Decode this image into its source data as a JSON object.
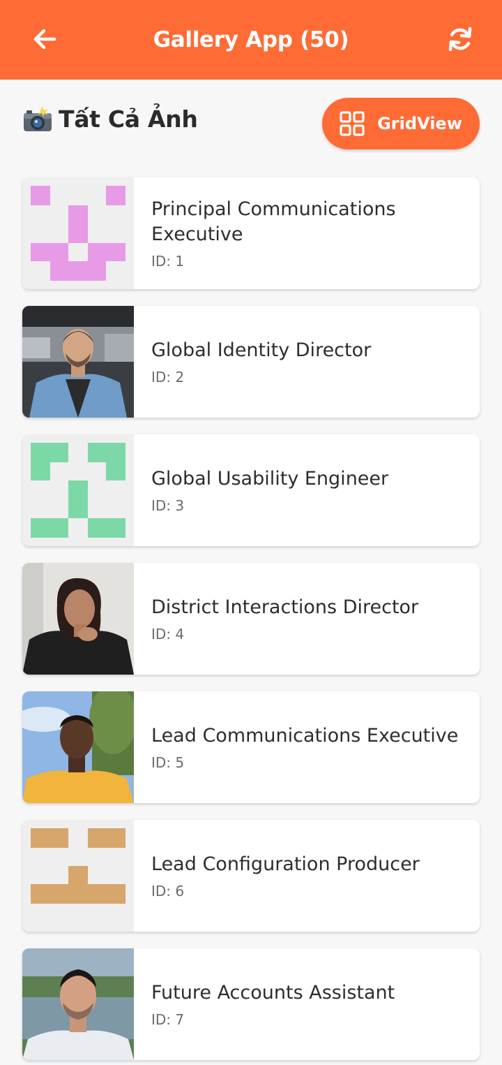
{
  "header": {
    "title": "Gallery App (50)",
    "back_icon": "arrow-left-icon",
    "refresh_icon": "refresh-icon",
    "bg_color": "#ff6b35"
  },
  "section": {
    "title": "Tất Cả Ảnh",
    "icon": "camera-flash-icon"
  },
  "view_toggle": {
    "label": "GridView",
    "icon": "grid-icon"
  },
  "items": [
    {
      "name": "Principal Communications Executive",
      "id_text": "ID: 1",
      "thumb": "identicon",
      "color": "#e79be6"
    },
    {
      "name": "Global Identity Director",
      "id_text": "ID: 2",
      "thumb": "photo"
    },
    {
      "name": "Global Usability Engineer",
      "id_text": "ID: 3",
      "thumb": "identicon",
      "color": "#7dd8a8"
    },
    {
      "name": "District Interactions Director",
      "id_text": "ID: 4",
      "thumb": "photo"
    },
    {
      "name": "Lead Communications Executive",
      "id_text": "ID: 5",
      "thumb": "photo"
    },
    {
      "name": "Lead Configuration Producer",
      "id_text": "ID: 6",
      "thumb": "identicon",
      "color": "#d6a66a"
    },
    {
      "name": "Future Accounts Assistant",
      "id_text": "ID: 7",
      "thumb": "photo"
    }
  ]
}
